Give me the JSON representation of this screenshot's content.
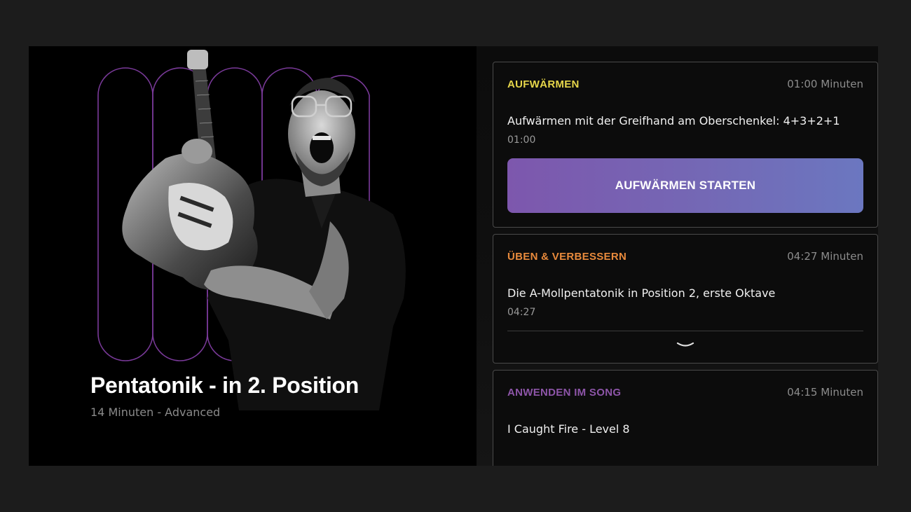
{
  "hero": {
    "title": "Pentatonik - in 2. Position",
    "subtitle": "14 Minuten - Advanced"
  },
  "sections": [
    {
      "label": "AUFWÄRMEN",
      "label_color": "#e6d64a",
      "duration": "01:00 Minuten",
      "lesson_title": "Aufwärmen mit der Greifhand am Oberschenkel: 4+3+2+1",
      "lesson_time": "01:00",
      "button_label": "AUFWÄRMEN STARTEN"
    },
    {
      "label": "ÜBEN & VERBESSERN",
      "label_color": "#e88a3c",
      "duration": "04:27 Minuten",
      "lesson_title": "Die A-Mollpentatonik in Position 2, erste Oktave",
      "lesson_time": "04:27",
      "expand_icon": "chevron-down-icon"
    },
    {
      "label": "ANWENDEN IM SONG",
      "label_color": "#8d55a8",
      "duration": "04:15 Minuten",
      "lesson_title": "I Caught Fire - Level 8"
    }
  ],
  "colors": {
    "accent_gradient_start": "#7d57ad",
    "accent_gradient_end": "#6b77c0",
    "arch_outline": "#7a3a9a"
  }
}
